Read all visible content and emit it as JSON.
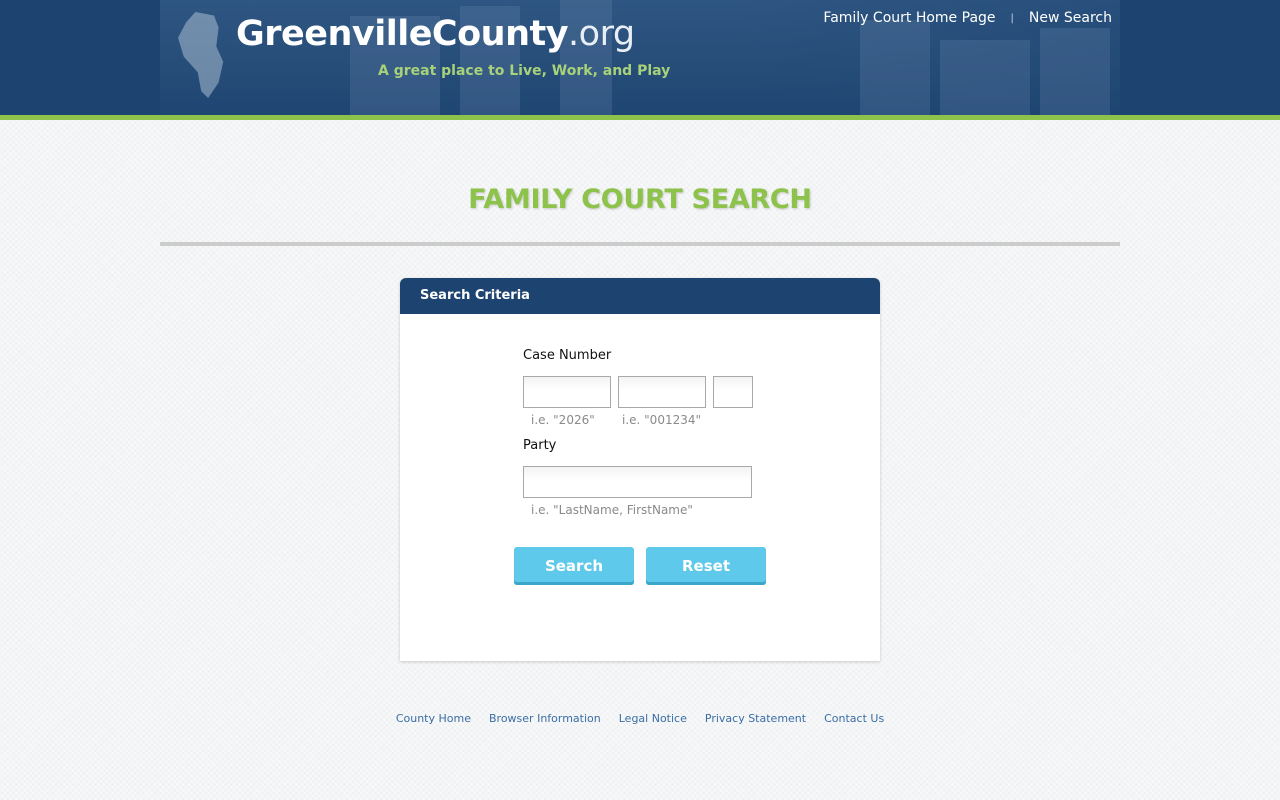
{
  "header": {
    "logo_main": "GreenvilleCounty",
    "logo_suffix": ".org",
    "tagline": "A great place to Live, Work, and Play",
    "nav": {
      "home_label": "Family Court Home Page",
      "separator": "|",
      "new_search_label": "New Search"
    }
  },
  "page": {
    "title": "FAMILY COURT SEARCH"
  },
  "panel": {
    "title": "Search Criteria",
    "case_number": {
      "label": "Case Number",
      "year_value": "",
      "number_value": "",
      "suffix_value": "",
      "year_hint": "i.e. \"2026\"",
      "number_hint": "i.e. \"001234\""
    },
    "party": {
      "label": "Party",
      "value": "",
      "hint": "i.e. \"LastName, FirstName\""
    },
    "buttons": {
      "search_label": "Search",
      "reset_label": "Reset"
    }
  },
  "footer": {
    "links": [
      "County Home",
      "Browser Information",
      "Legal Notice",
      "Privacy Statement",
      "Contact Us"
    ]
  },
  "colors": {
    "brand_blue": "#1d4370",
    "accent_green": "#8dc24b",
    "button_blue": "#5ec9ea",
    "link_blue": "#3a6ea5"
  }
}
